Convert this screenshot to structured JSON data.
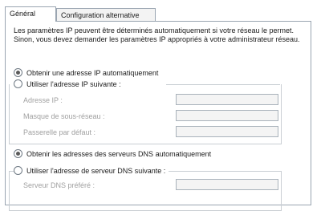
{
  "tabs": [
    {
      "label": "Général"
    },
    {
      "label": "Configuration alternative"
    }
  ],
  "description": "Les paramètres IP peuvent être déterminés automatiquement si votre réseau le permet. Sinon, vous devez demander les paramètres IP appropriés à votre administrateur réseau.",
  "ip": {
    "auto_label": "Obtenir une adresse IP automatiquement",
    "manual_label": "Utiliser l'adresse IP suivante :",
    "fields": [
      {
        "label": "Adresse IP :",
        "value": ""
      },
      {
        "label": "Masque de sous-réseau :",
        "value": ""
      },
      {
        "label": "Passerelle par défaut :",
        "value": ""
      }
    ]
  },
  "dns": {
    "auto_label": "Obtenir les adresses des serveurs DNS automatiquement",
    "manual_label": "Utiliser l'adresse de serveur DNS suivante :",
    "fields": [
      {
        "label": "Serveur DNS préféré :",
        "value": ""
      }
    ]
  }
}
